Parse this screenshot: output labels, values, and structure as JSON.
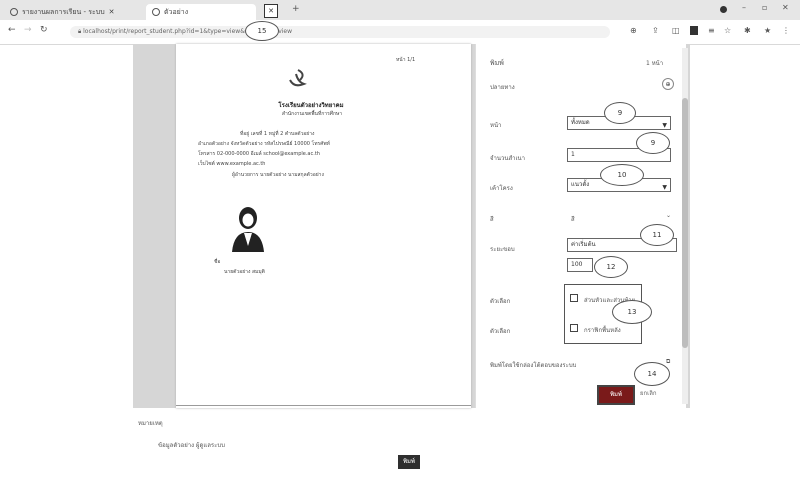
{
  "browser": {
    "tabs": [
      {
        "title": "รายงานผลการเรียน - ระบบ"
      },
      {
        "title": "ตัวอย่าง"
      }
    ],
    "new_tab_symbol": "+",
    "url": "localhost/print/report_student.php?id=1&type=view&action=preview"
  },
  "doc": {
    "header_right": "หน้า 1/1",
    "org_title": "โรงเรียนตัวอย่างวิทยาคม",
    "org_sub": "สำนักงานเขตพื้นที่การศึกษา",
    "lines": [
      "ที่อยู่ เลขที่ 1 หมู่ที่ 2 ตำบลตัวอย่าง",
      "อำเภอตัวอย่าง จังหวัดตัวอย่าง รหัสไปรษณีย์ 10000 โทรศัพท์",
      "โทรสาร 02-000-0000 อีเมล์ school@example.ac.th",
      "เว็บไซต์ www.example.ac.th",
      "ผู้อำนวยการ นายตัวอย่าง นามสกุลตัวอย่าง"
    ],
    "person_label": "ชื่อ",
    "person_name": "นายตัวอย่าง สมมุติ"
  },
  "panel": {
    "title": "พิมพ์",
    "count": "1 หน้า",
    "printer_label": "ปลายทาง",
    "pages_label": "หน้า",
    "pages_value": "ทั้งหมด",
    "copies_label": "จำนวนสำเนา",
    "copies_value": "1",
    "layout_label": "เค้าโครง",
    "layout_value": "แนวตั้ง",
    "color_label": "สี",
    "color_value": "สี",
    "margins_label": "ระยะขอบ",
    "margins_value": "ค่าเริ่มต้น",
    "scale_value": "100",
    "options_label": "ตัวเลือก",
    "option1": "ส่วนหัวและส่วนท้าย",
    "option2_label": "ตัวเลือก",
    "option2": "กราฟิกพื้นหลัง",
    "system_dialog": "พิมพ์โดยใช้กล่องโต้ตอบของระบบ",
    "print_button": "พิมพ์",
    "cancel_button": "ยกเลิก"
  },
  "callouts": [
    "9",
    "9",
    "10",
    "11",
    "12",
    "13",
    "14",
    "15"
  ],
  "footer": {
    "label": "หมายเหตุ",
    "text": "ข้อมูลตัวอย่าง ผู้ดูแลระบบ",
    "button": "พิมพ์"
  }
}
